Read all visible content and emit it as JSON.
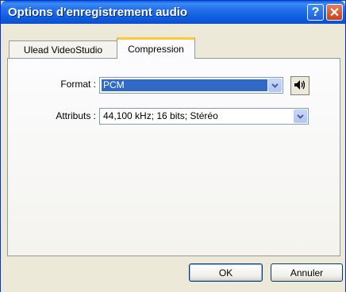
{
  "window": {
    "title": "Options d'enregistrement audio"
  },
  "titlebar": {
    "help_label": "?",
    "close_label": "✕"
  },
  "tabs": [
    {
      "label": "Ulead VideoStudio",
      "selected": false
    },
    {
      "label": "Compression",
      "selected": true
    }
  ],
  "format": {
    "label": "Format :",
    "value": "PCM"
  },
  "attributes": {
    "label": "Attributs :",
    "value": "44,100 kHz; 16 bits; Stéréo"
  },
  "buttons": {
    "ok": "OK",
    "cancel": "Annuler"
  },
  "icons": {
    "speaker": "speaker-icon",
    "dropdown": "chevron-down-icon"
  },
  "colors": {
    "titlebar": "#0a5fd8",
    "selection": "#316ac5",
    "tab_accent": "#ffc83c"
  }
}
